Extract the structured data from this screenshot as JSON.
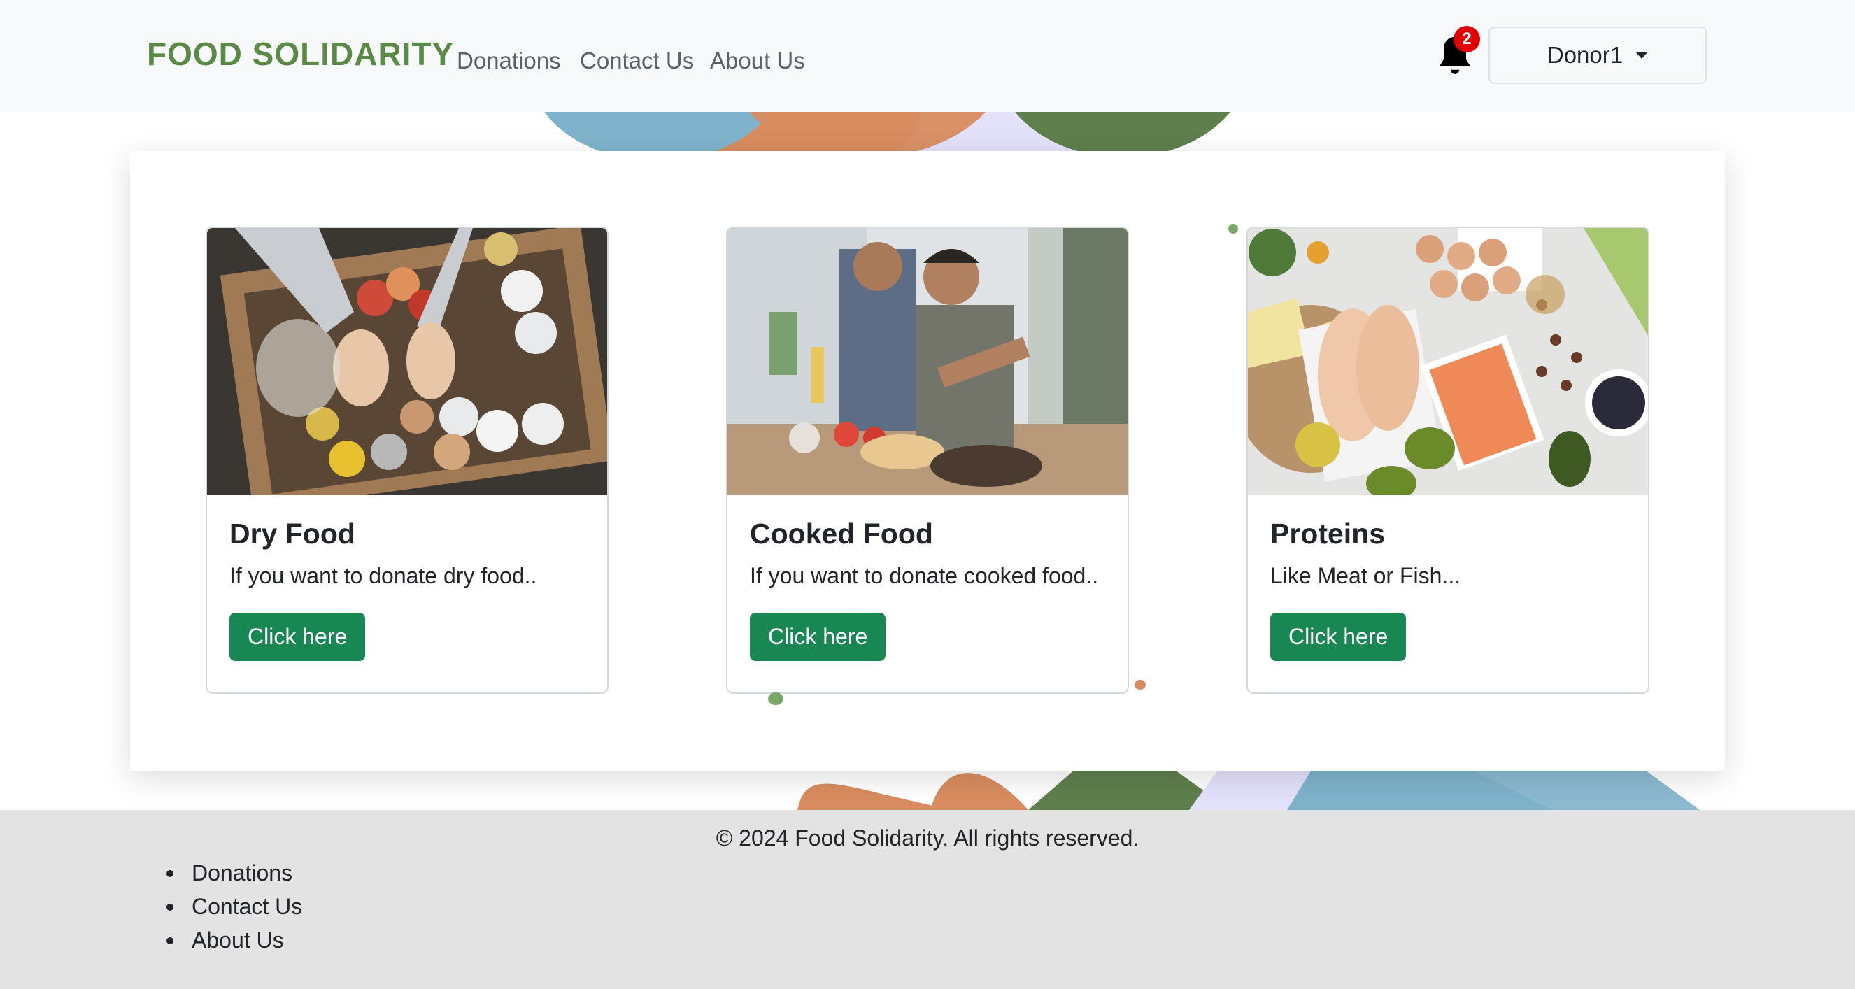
{
  "navbar": {
    "brand": "FOOD SOLIDARITY",
    "links": [
      "Donations",
      "Contact Us",
      "About Us"
    ],
    "notification_count": "2",
    "user_menu_label": "Donor1"
  },
  "cards": [
    {
      "title": "Dry Food",
      "text": "If you want to donate dry food..",
      "button": "Click here",
      "image": "dry-food-box-photo"
    },
    {
      "title": "Cooked Food",
      "text": "If you want to donate cooked food..",
      "button": "Click here",
      "image": "people-cooking-photo"
    },
    {
      "title": "Proteins",
      "text": "Like Meat or Fish...",
      "button": "Click here",
      "image": "proteins-flatlay-photo"
    }
  ],
  "footer": {
    "copyright": "© 2024 Food Solidarity. All rights reserved.",
    "links": [
      "Donations",
      "Contact Us",
      "About Us"
    ]
  },
  "colors": {
    "brand": "#5b8a47",
    "button": "#198754",
    "badge": "#e00000",
    "deco_blue": "#7fb3cc",
    "deco_orange": "#d98c5f",
    "deco_green": "#5f7f4d",
    "deco_lavender": "#e4e1fb",
    "footer_bg": "#e3e3e3"
  }
}
